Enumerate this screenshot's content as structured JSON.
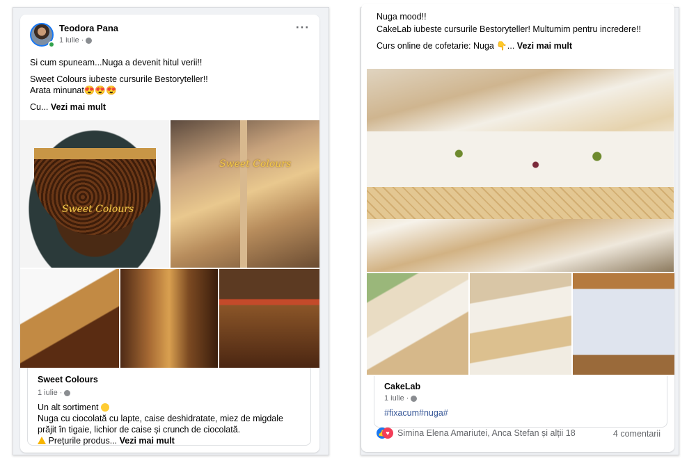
{
  "left_post": {
    "author": "Teodora Pana",
    "date": "1 iulie",
    "line1": "Si cum spuneam...Nuga a devenit hitul verii!!",
    "line2": "Sweet Colours iubeste cursurile Bestoryteller!!",
    "line3": "Arata minunat😍😍😍",
    "line4_prefix": "Cu...",
    "see_more": "Vezi mai mult",
    "watermark": "Sweet Colours",
    "shared": {
      "title": "Sweet Colours",
      "date": "1 iulie",
      "line1": "Un alt sortiment",
      "line2": "Nuga cu ciocolată cu lapte, caise deshidratate, miez de migdale",
      "line3": "prăjit în tigaie, lichior de caise și crunch de ciocolată.",
      "line4_prefix": "Prețurile produs...",
      "see_more": "Vezi mai mult"
    }
  },
  "right_post": {
    "line1": "Nuga mood!!",
    "line2": "CakeLab iubeste cursurile Bestoryteller! Multumim pentru incredere!!",
    "line3_prefix": "Curs online de cofetarie: Nuga 👇...",
    "see_more": "Vezi mai mult",
    "shared": {
      "title": "CakeLab",
      "date": "1 iulie",
      "hashtags": "#fixacum#nuga#"
    },
    "reactions_text": "Simina Elena Amariutei, Anca Stefan și alții 18",
    "comments_text": "4 comentarii"
  },
  "icons": {
    "more": "more-options-icon",
    "globe": "globe-icon",
    "like": "like-reaction-icon",
    "love": "love-reaction-icon",
    "warning": "warning-icon"
  }
}
